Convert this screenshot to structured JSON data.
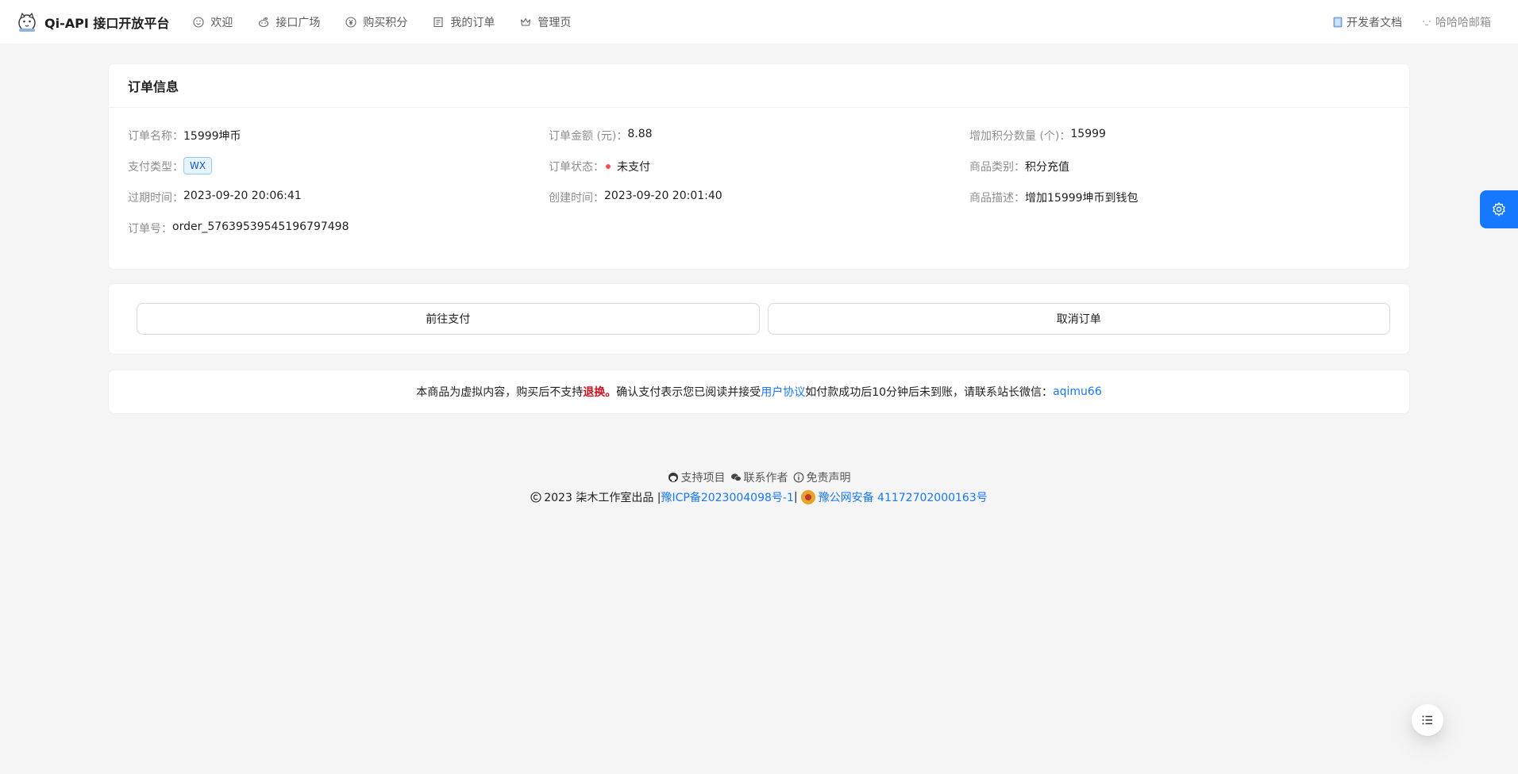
{
  "header": {
    "title": "Qi-API 接口开放平台",
    "nav": [
      {
        "label": "欢迎",
        "icon": "smile-icon"
      },
      {
        "label": "接口广场",
        "icon": "reddit-icon"
      },
      {
        "label": "购买积分",
        "icon": "pay-circle-icon"
      },
      {
        "label": "我的订单",
        "icon": "profile-icon"
      },
      {
        "label": "管理页",
        "icon": "crown-icon"
      }
    ],
    "docs_label": "开发者文档",
    "user_label": "哈哈哈邮箱"
  },
  "order": {
    "title": "订单信息",
    "rows": [
      [
        {
          "label": "订单名称：",
          "value": "15999坤币"
        },
        {
          "label": "订单金额 (元)：",
          "value": "8.88"
        },
        {
          "label": "增加积分数量 (个)：",
          "value": "15999"
        }
      ],
      [
        {
          "label": "支付类型：",
          "value": "WX"
        },
        {
          "label": "订单状态：",
          "value": "未支付"
        },
        {
          "label": "商品类别：",
          "value": "积分充值"
        }
      ],
      [
        {
          "label": "过期时间：",
          "value": "2023-09-20 20:06:41"
        },
        {
          "label": "创建时间：",
          "value": "2023-09-20 20:01:40"
        },
        {
          "label": "商品描述：",
          "value": "增加15999坤币到钱包"
        }
      ],
      [
        {
          "label": "订单号：",
          "value": "order_57639539545196797498"
        }
      ]
    ]
  },
  "actions": {
    "pay_label": "前往支付",
    "cancel_label": "取消订单"
  },
  "notice": {
    "text1": "本商品为虚拟内容，购买后不支持",
    "red": "退换。",
    "text2": "确认支付表示您已阅读并接受 ",
    "agreement": "用户协议",
    "text3": " 如付款成功后10分钟后未到账，请联系站长微信：",
    "wechat": "aqimu66"
  },
  "footer": {
    "links": [
      {
        "label": "支持项目",
        "icon": "github-icon"
      },
      {
        "label": "联系作者",
        "icon": "wechat-icon"
      },
      {
        "label": "免责声明",
        "icon": "info-circle-icon"
      }
    ],
    "copyright": "2023 柒木工作室出品 | ",
    "icp": "豫ICP备2023004098号-1",
    "sep": " | ",
    "police": "豫公网安备 41172702000163号"
  },
  "colors": {
    "primary": "#1677ff",
    "danger": "#ff4d4f",
    "background": "#f5f5f5"
  }
}
